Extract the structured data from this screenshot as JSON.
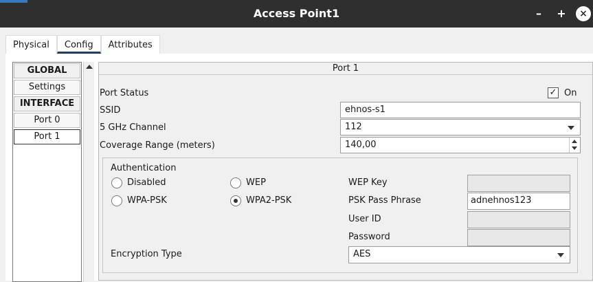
{
  "window": {
    "title": "Access Point1",
    "minimize": "–",
    "maximize": "+",
    "close": "×"
  },
  "tabs": [
    {
      "label": "Physical"
    },
    {
      "label": "Config"
    },
    {
      "label": "Attributes"
    }
  ],
  "sidebar": {
    "items": [
      {
        "label": "GLOBAL"
      },
      {
        "label": "Settings"
      },
      {
        "label": "INTERFACE"
      },
      {
        "label": "Port 0"
      },
      {
        "label": "Port 1"
      }
    ]
  },
  "panel": {
    "title": "Port 1",
    "port_status_label": "Port Status",
    "port_status_checked": "✓",
    "port_status_on": "On",
    "ssid_label": "SSID",
    "ssid_value": "ehnos-s1",
    "channel_label": "5 GHz Channel",
    "channel_value": "112",
    "coverage_label": "Coverage Range (meters)",
    "coverage_value": "140,00"
  },
  "auth": {
    "title": "Authentication",
    "options": {
      "disabled": "Disabled",
      "wep": "WEP",
      "wpa_psk": "WPA-PSK",
      "wpa2_psk": "WPA2-PSK"
    },
    "wep_key_label": "WEP Key",
    "psk_label": "PSK Pass Phrase",
    "psk_value": "adnehnos123",
    "user_id_label": "User ID",
    "password_label": "Password",
    "encryption_label": "Encryption Type",
    "encryption_value": "AES"
  }
}
